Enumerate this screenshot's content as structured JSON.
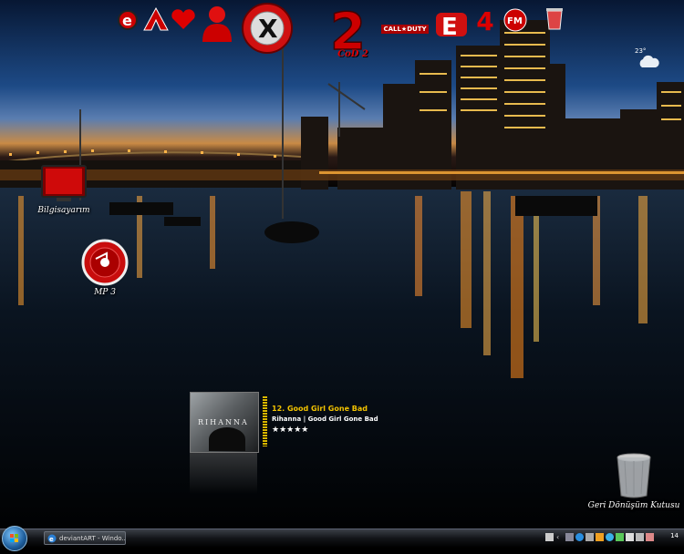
{
  "desktop": {
    "icons": [
      {
        "label": "Bilgisayarım"
      },
      {
        "label": "MP 3"
      },
      {
        "label": "Geri Dönüşüm Kutusu"
      }
    ]
  },
  "dock": {
    "cod_label": "CoD 2",
    "cod_number": "2",
    "call_of_duty_text": "CALL★DUTY",
    "fm_label": "FM",
    "four_label": "4",
    "x_label": "X"
  },
  "weather": {
    "temp": "23°"
  },
  "player": {
    "track": "12. Good Girl Gone Bad",
    "artist_album": "Rihanna | Good Girl Gone Bad",
    "rating_text": "★★★★★",
    "album_text": "RIHANNA",
    "rating": 5
  },
  "taskbar": {
    "window_button": "deviantART - Windo...",
    "clock": "14"
  },
  "colors": {
    "accent": "#cc0000",
    "sky_top": "#0b1c3a",
    "water": "#000000",
    "gold": "#f2c200"
  }
}
